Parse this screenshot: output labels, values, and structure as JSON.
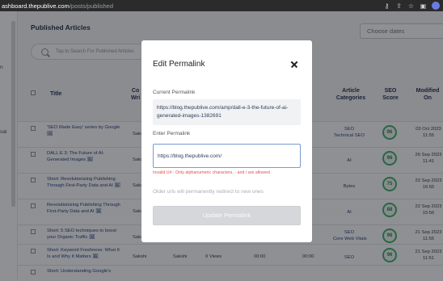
{
  "browser": {
    "url_host": "ashboard.thepublive.com",
    "url_path": "/posts/published"
  },
  "sidebar": {
    "fragment_1": "n",
    "fragment_2": "val"
  },
  "page": {
    "title": "Published Articles",
    "dates_placeholder": "Choose dates",
    "search_placeholder": "Tap to Search For Published Articles"
  },
  "table": {
    "headers": {
      "title": "Title",
      "writer": "Co\nWri",
      "url_views": "d\nr",
      "article_categories": "Article\nCategories",
      "seo_score": "SEO\nScore",
      "modified_on": "Modified\nOn"
    },
    "rows": [
      {
        "title": "'SEO Made Easy' series by Google 🖼",
        "writer": "Saksh",
        "categories": "SEO\nTechnical SEO",
        "score": "96",
        "modified": "03 Oct 2023\n11:55"
      },
      {
        "title": "DALL E 3: The Future of AI-Generated Images 🖼",
        "writer": "Saksh",
        "categories": "AI",
        "score": "96",
        "modified": "26 Sep 2023\n11:41"
      },
      {
        "title": "Short: Revolutionizing Publishing Through First-Party Data and AI 🖼",
        "writer": "Saksh",
        "categories": "Bytes",
        "score": "75",
        "modified": "22 Sep 2023\n16:55"
      },
      {
        "title": "Revolutionizing Publishing Through First-Party Data and AI 🖼",
        "writer": "Saksh",
        "categories": "AI",
        "score": "88",
        "modified": "22 Sep 2023\n15:56"
      },
      {
        "title": "Short: 5 SEO techniques to boost your Organic Traffic 🖼",
        "writer": "Saksh",
        "categories": "SEO\nCore Web Vitals",
        "score": "96",
        "modified": "21 Sep 2023\n11:55"
      },
      {
        "title": "Short: Keyword Freshness: What It Is and Why It Matters 🖼",
        "writer": "Sakshi",
        "writer2": "Sakshi",
        "views": "0 Views",
        "time": "00:00",
        "categories": "SEO",
        "score": "96",
        "modified": "21 Sep 2023\n11:51"
      },
      {
        "title": "Short: Understanding Google's",
        "writer": "",
        "categories": "",
        "score": "",
        "modified": ""
      }
    ]
  },
  "modal": {
    "title": "Edit Permalink",
    "current_label": "Current Permalink",
    "current_value": "https://blog.thepublive.com/amp/dall-e-3-the-future-of-ai-generated-images-1382691",
    "enter_label": "Enter Permalink",
    "input_value": "https://blog.thepublive.com/",
    "error": "Invalid Url : Only alphanumeric characters, - and / are allowed",
    "hint": "Older urls will permanently redirect to new ones",
    "button": "Update Permalink"
  },
  "colors": {
    "score_ring": "#3fae6a",
    "link_blue": "#1b3a7a",
    "error_red": "#e05050",
    "overlay": "rgba(20,22,30,0.48)"
  }
}
